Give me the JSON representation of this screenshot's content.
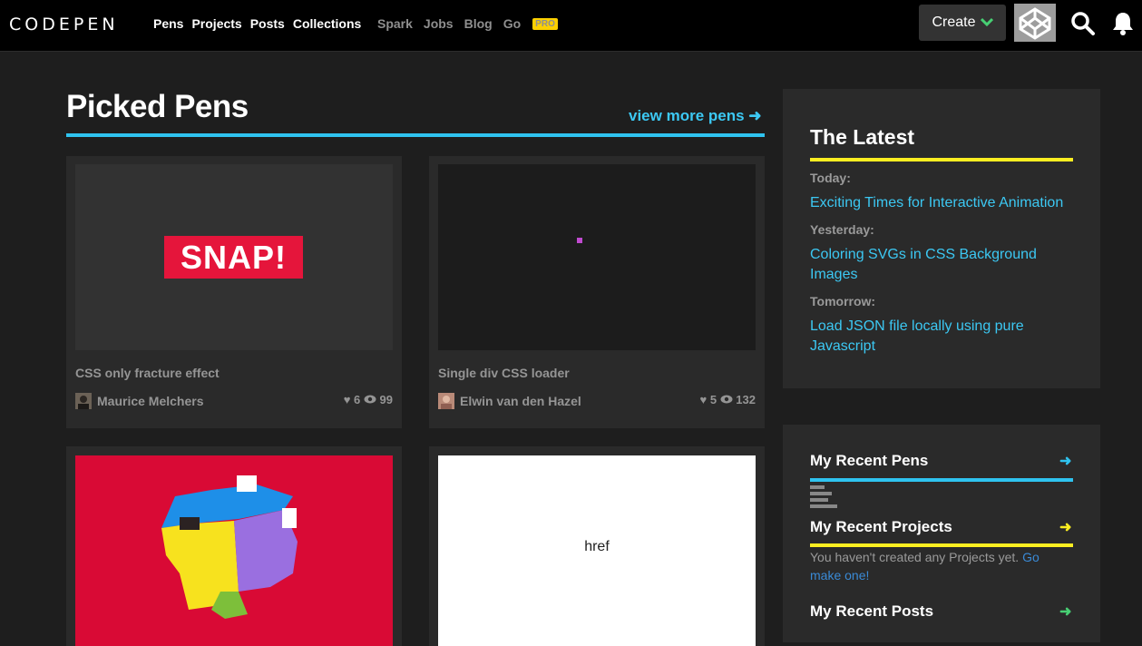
{
  "brand": {
    "logo_text": "CODEPEN"
  },
  "nav": {
    "primary": [
      "Pens",
      "Projects",
      "Posts",
      "Collections"
    ],
    "secondary": [
      "Spark",
      "Jobs",
      "Blog"
    ],
    "go_label": "Go",
    "pro_badge": "PRO"
  },
  "header": {
    "create_label": "Create",
    "icons": {
      "search": "search-icon",
      "notifications": "bell-icon",
      "create_chevron": "chevron-down-icon"
    }
  },
  "picked": {
    "heading": "Picked Pens",
    "view_more": "view more pens",
    "cards": [
      {
        "title": "CSS only fracture effect",
        "user": "Maurice Melchers",
        "likes": "6",
        "views": "99",
        "preview_text": "SNAP!"
      },
      {
        "title": "Single div CSS loader",
        "user": "Elwin van den Hazel",
        "likes": "5",
        "views": "132"
      },
      {
        "title": "",
        "user": ""
      },
      {
        "title": "",
        "user": "",
        "preview_text": "href"
      }
    ]
  },
  "latest": {
    "heading": "The Latest",
    "items": [
      {
        "when": "Today:",
        "title": "Exciting Times for Interactive Animation"
      },
      {
        "when": "Yesterday:",
        "title": "Coloring SVGs in CSS Background Images"
      },
      {
        "when": "Tomorrow:",
        "title": "Load JSON file locally using pure Javascript"
      }
    ]
  },
  "recent": {
    "pens": {
      "heading": "My Recent Pens"
    },
    "projects": {
      "heading": "My Recent Projects",
      "empty_text": "You haven't created any Projects yet.",
      "empty_link": "Go make one!"
    },
    "posts": {
      "heading": "My Recent Posts"
    }
  },
  "colors": {
    "blue_accent": "#2fc3ef",
    "yellow_accent": "#fcee21",
    "green_accent": "#47cf73",
    "pro_badge": "#fcd000",
    "snap_red": "#e5153b"
  }
}
